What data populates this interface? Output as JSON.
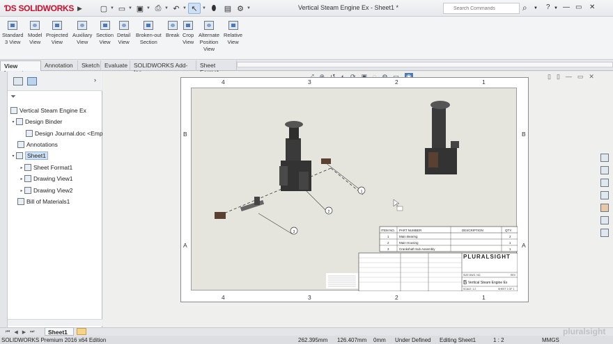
{
  "app": {
    "logo_text": "SOLIDWORKS",
    "document_title": "Vertical Steam Engine Ex - Sheet1 *",
    "search_placeholder": "Search Commands"
  },
  "command_manager": [
    {
      "label": "Standard\n3 View"
    },
    {
      "label": "Model\nView"
    },
    {
      "label": "Projected\nView"
    },
    {
      "label": "Auxiliary\nView"
    },
    {
      "label": "Section\nView"
    },
    {
      "label": "Detail\nView"
    },
    {
      "label": "Broken-out\nSection"
    },
    {
      "label": "Break"
    },
    {
      "label": "Crop\nView"
    },
    {
      "label": "Alternate\nPosition\nView"
    },
    {
      "label": "Relative\nView"
    }
  ],
  "tabs": [
    {
      "label": "View Layout",
      "active": true
    },
    {
      "label": "Annotation",
      "active": false
    },
    {
      "label": "Sketch",
      "active": false
    },
    {
      "label": "Evaluate",
      "active": false
    },
    {
      "label": "SOLIDWORKS Add-Ins",
      "active": false
    },
    {
      "label": "Sheet Format",
      "active": false
    }
  ],
  "feature_tree": {
    "items": [
      {
        "label": "Vertical Steam Engine Ex",
        "level": 0,
        "toggle": ""
      },
      {
        "label": "Design Binder",
        "level": 1,
        "toggle": "▾"
      },
      {
        "label": "Design Journal.doc <Emp",
        "level": 2,
        "toggle": ""
      },
      {
        "label": "Annotations",
        "level": 1,
        "toggle": ""
      },
      {
        "label": "Sheet1",
        "level": 1,
        "toggle": "▾",
        "selected": true
      },
      {
        "label": "Sheet Format1",
        "level": 2,
        "toggle": "▸"
      },
      {
        "label": "Drawing View1",
        "level": 2,
        "toggle": "▸"
      },
      {
        "label": "Drawing View2",
        "level": 2,
        "toggle": "▸"
      },
      {
        "label": "Bill of Materials1",
        "level": 1,
        "toggle": ""
      }
    ]
  },
  "sheet": {
    "zones_top": [
      "4",
      "3",
      "2",
      "1"
    ],
    "zones_bottom": [
      "4",
      "3",
      "2",
      "1"
    ],
    "zones_side": [
      "B",
      "A"
    ],
    "balloons": [
      "1",
      "2",
      "3"
    ]
  },
  "bom": {
    "headers": [
      "ITEM NO.",
      "PART NUMBER",
      "DESCRIPTION",
      "QTY."
    ],
    "rows": [
      [
        "1",
        "Main Bearing",
        "",
        "2"
      ],
      [
        "2",
        "Main Housing",
        "",
        "1"
      ],
      [
        "3",
        "Crankshaft Sub Assembly",
        "",
        "1"
      ]
    ]
  },
  "title_block": {
    "company": "PLURALSIGHT",
    "drawing_title": "Vertical Steam Engine Ex",
    "dwg_label": "SIZE DWG. NO.",
    "rev_label": "REV",
    "size": "B",
    "scale": "SCALE: 1:2",
    "sheet": "SHEET 1 OF 1"
  },
  "status": {
    "edition": "SOLIDWORKS Premium 2016 x64 Edition",
    "x": "262.395mm",
    "y": "126.407mm",
    "z": "0mm",
    "definition": "Under Defined",
    "editing": "Editing Sheet1",
    "scale": "1 : 2",
    "units": "MMGS"
  },
  "sheet_tab": "Sheet1",
  "watermark": "pluralsight",
  "colors": {
    "brand": "#c8102e",
    "selection": "#cfe0f3",
    "paper": "#e6e5dd"
  }
}
